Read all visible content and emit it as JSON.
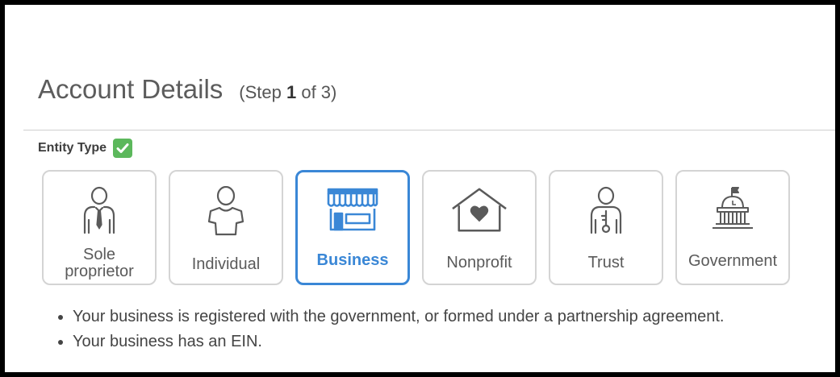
{
  "header": {
    "title": "Account Details",
    "step_prefix": "(Step ",
    "step_current": "1",
    "step_suffix": " of 3)"
  },
  "entity_type": {
    "label": "Entity Type",
    "status_icon": "check-icon",
    "status_color": "#5cb85c",
    "options": [
      {
        "line1": "Sole",
        "line2": "proprietor",
        "icon": "person-tie-icon",
        "selected": false
      },
      {
        "line1": "Individual",
        "icon": "person-icon",
        "selected": false
      },
      {
        "line1": "Business",
        "icon": "storefront-icon",
        "selected": true
      },
      {
        "line1": "Nonprofit",
        "icon": "house-heart-icon",
        "selected": false
      },
      {
        "line1": "Trust",
        "icon": "person-key-icon",
        "selected": false
      },
      {
        "line1": "Government",
        "icon": "capitol-building-icon",
        "selected": false
      }
    ]
  },
  "description": {
    "bullets": [
      "Your business is registered with the government, or formed under a partnership agreement.",
      "Your business has an EIN."
    ]
  },
  "colors": {
    "accent": "#3a87d6",
    "card_border": "#d4d4d4",
    "icon_stroke": "#5a5a5a"
  }
}
